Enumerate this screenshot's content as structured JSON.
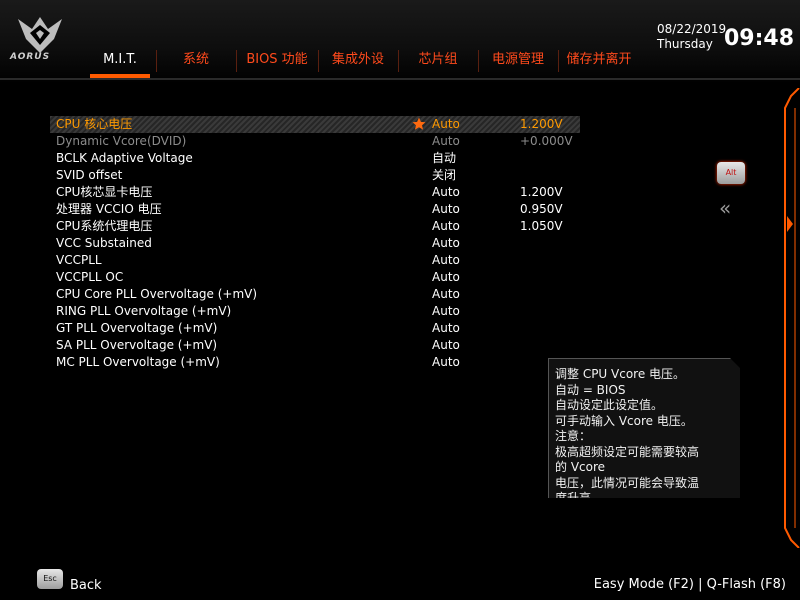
{
  "header": {
    "brand": "AORUS",
    "tabs": [
      {
        "label": "M.I.T.",
        "active": true
      },
      {
        "label": "系统",
        "active": false
      },
      {
        "label": "BIOS 功能",
        "active": false
      },
      {
        "label": "集成外设",
        "active": false
      },
      {
        "label": "芯片组",
        "active": false
      },
      {
        "label": "电源管理",
        "active": false
      },
      {
        "label": "储存并离开",
        "active": false
      }
    ],
    "date": "08/22/2019",
    "weekday": "Thursday",
    "time": "09:48"
  },
  "settings": [
    {
      "label": "CPU 核心电压",
      "value": "Auto",
      "value2": "1.200V",
      "selected": true,
      "favorite": true
    },
    {
      "label": "Dynamic Vcore(DVID)",
      "value": "Auto",
      "value2": "+0.000V",
      "dim": true
    },
    {
      "label": "BCLK Adaptive Voltage",
      "value": "自动",
      "value2": ""
    },
    {
      "label": "SVID offset",
      "value": "关闭",
      "value2": ""
    },
    {
      "label": "CPU核芯显卡电压",
      "value": "Auto",
      "value2": "1.200V"
    },
    {
      "label": "处理器 VCCIO 电压",
      "value": "Auto",
      "value2": "0.950V"
    },
    {
      "label": "CPU系统代理电压",
      "value": "Auto",
      "value2": "1.050V"
    },
    {
      "label": "VCC Substained",
      "value": "Auto",
      "value2": ""
    },
    {
      "label": "VCCPLL",
      "value": "Auto",
      "value2": ""
    },
    {
      "label": "VCCPLL OC",
      "value": "Auto",
      "value2": ""
    },
    {
      "label": "CPU Core PLL Overvoltage (+mV)",
      "value": "Auto",
      "value2": ""
    },
    {
      "label": "RING PLL Overvoltage (+mV)",
      "value": "Auto",
      "value2": ""
    },
    {
      "label": "GT PLL Overvoltage (+mV)",
      "value": "Auto",
      "value2": ""
    },
    {
      "label": "SA PLL Overvoltage (+mV)",
      "value": "Auto",
      "value2": ""
    },
    {
      "label": "MC PLL Overvoltage (+mV)",
      "value": "Auto",
      "value2": ""
    }
  ],
  "side": {
    "alt_label": "Alt",
    "chevron": "«"
  },
  "help": {
    "lines": [
      "调整 CPU Vcore 电压。",
      "自动 = BIOS",
      "自动设定此设定值。",
      "可手动输入 Vcore 电压。",
      "注意：",
      "极高超频设定可能需要较高",
      "的 Vcore",
      "电压，此情况可能会导致温",
      "度升高。"
    ]
  },
  "footer": {
    "esc_label": "Esc",
    "back_label": "Back",
    "shortcuts": "Easy Mode (F2)  |  Q-Flash (F8)"
  },
  "colors": {
    "accent": "#ff5a00",
    "tab_text": "#ff4a1c",
    "selected_text": "#ff9a00"
  }
}
